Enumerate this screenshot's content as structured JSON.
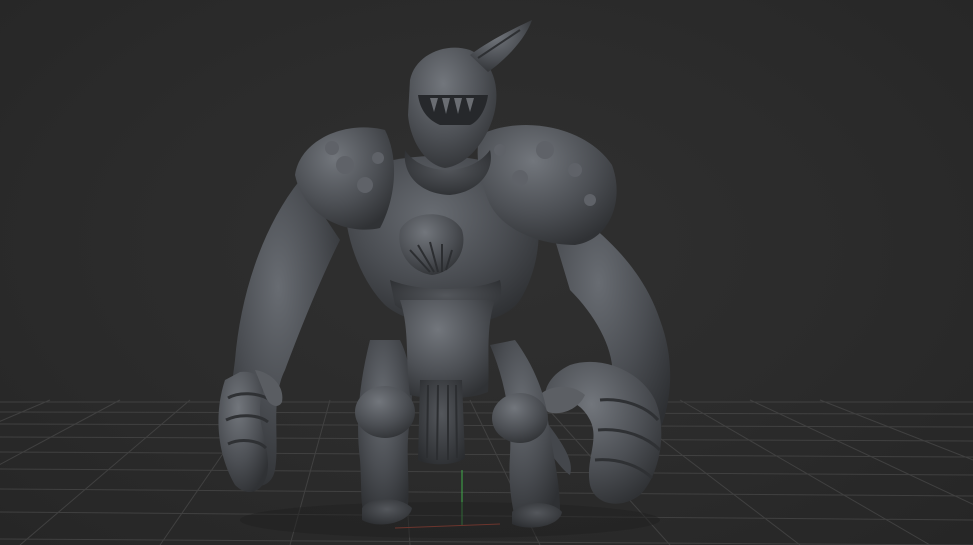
{
  "viewport": {
    "background_color": "#2b2b2b",
    "grid_color": "#4a4a4a",
    "axis_x_color": "#b84a3a",
    "axis_y_color": "#3fae4a",
    "model_base_color": "#4a4d52",
    "model_shadow_color": "#2e3033",
    "model_highlight_color": "#6a6e74"
  },
  "scene": {
    "object": "armored-golem-sculpt",
    "view": "perspective"
  }
}
